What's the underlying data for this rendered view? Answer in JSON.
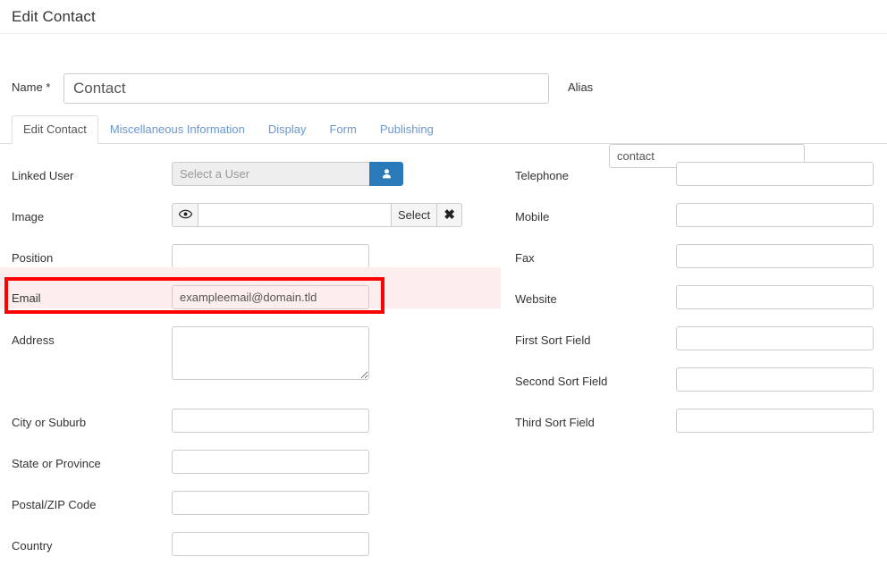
{
  "header": {
    "title": "Edit Contact"
  },
  "name_row": {
    "name_label": "Name",
    "required_marker": "*",
    "name_value": "Contact",
    "name_placeholder": "",
    "alias_label": "Alias",
    "alias_value": "contact",
    "alias_placeholder": ""
  },
  "tabs": [
    {
      "label": "Edit Contact",
      "active": true
    },
    {
      "label": "Miscellaneous Information",
      "active": false
    },
    {
      "label": "Display",
      "active": false
    },
    {
      "label": "Form",
      "active": false
    },
    {
      "label": "Publishing",
      "active": false
    }
  ],
  "left_column": {
    "linked_user": {
      "label": "Linked User",
      "value": "",
      "placeholder": "Select a User",
      "button_icon": "user-icon"
    },
    "image": {
      "label": "Image",
      "value": "",
      "placeholder": "",
      "preview_icon": "eye-icon",
      "select_label": "Select",
      "clear_icon": "close-x-icon",
      "clear_glyph": "✖"
    },
    "position": {
      "label": "Position",
      "value": "",
      "placeholder": ""
    },
    "email": {
      "label": "Email",
      "value": "exampleemail@domain.tld",
      "placeholder": "",
      "highlighted": true,
      "highlight_color": "#ff0000",
      "highlight_fill": "#fdeeee"
    },
    "address": {
      "label": "Address",
      "value": "",
      "placeholder": ""
    },
    "city": {
      "label": "City or Suburb",
      "value": "",
      "placeholder": ""
    },
    "state": {
      "label": "State or Province",
      "value": "",
      "placeholder": ""
    },
    "postal": {
      "label": "Postal/ZIP Code",
      "value": "",
      "placeholder": ""
    },
    "country": {
      "label": "Country",
      "value": "",
      "placeholder": ""
    }
  },
  "right_column": {
    "telephone": {
      "label": "Telephone",
      "value": "",
      "placeholder": ""
    },
    "mobile": {
      "label": "Mobile",
      "value": "",
      "placeholder": ""
    },
    "fax": {
      "label": "Fax",
      "value": "",
      "placeholder": ""
    },
    "website": {
      "label": "Website",
      "value": "",
      "placeholder": ""
    },
    "first_sort": {
      "label": "First Sort Field",
      "value": "",
      "placeholder": ""
    },
    "second_sort": {
      "label": "Second Sort Field",
      "value": "",
      "placeholder": ""
    },
    "third_sort": {
      "label": "Third Sort Field",
      "value": "",
      "placeholder": ""
    }
  },
  "colors": {
    "accent_blue": "#2a7ab9",
    "link_blue": "#6a96cf",
    "border_gray": "#cccccc",
    "highlight_red": "#ff0000",
    "highlight_bg": "#fdeeee"
  }
}
